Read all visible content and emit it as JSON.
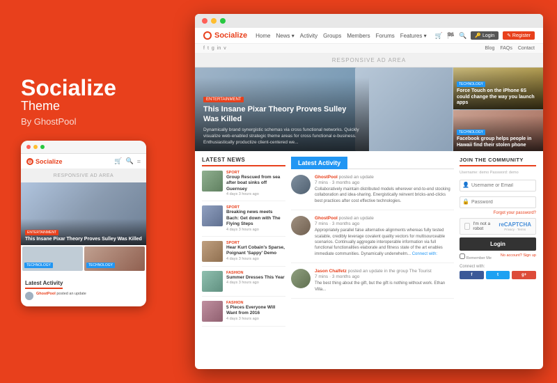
{
  "brand": {
    "title": "Socialize",
    "subtitle": "Theme",
    "by": "By GhostPool"
  },
  "browser_dots": [
    "red",
    "yellow",
    "green"
  ],
  "site": {
    "logo": "Socialize",
    "nav": [
      "Home",
      "News ▾",
      "Activity",
      "Groups",
      "Members",
      "Forums",
      "Features ▾"
    ],
    "nav_icons": [
      "🛒",
      "🔍",
      "Login",
      "Register"
    ],
    "secondary_nav": [
      "Blog",
      "FAQs",
      "Contact"
    ],
    "social_links": [
      "f",
      "t",
      "g+",
      "in",
      "v"
    ]
  },
  "ad_area": "RESPONSIVE AD AREA",
  "hero": {
    "tag": "ENTERTAINMENT",
    "title": "This Insane Pixar Theory Proves Sulley Was Killed",
    "desc": "Dynamically brand synergistic schemas via cross functional networks. Quickly visualize web-enabled strategic theme areas for cross functional e-business. Enthusiastically productize client-centered we...",
    "card1_tag": "TECHNOLOGY",
    "card1_title": "Force Touch on the iPhone 6S could change the way you launch apps",
    "card2_tag": "TECHNOLOGY",
    "card2_title": "Facebook group helps people in Hawaii find their stolen phone"
  },
  "latest_news": {
    "header": "LATEST NEWS",
    "items": [
      {
        "category": "SPORT",
        "title": "Group Rescued from sea after boat sinks off Guernsey",
        "date": "4 days 3 hours ago",
        "thumb": "green"
      },
      {
        "category": "SPORT",
        "title": "Breaking news meets Bach: Get down with The Flying Steps",
        "date": "4 days 3 hours ago",
        "thumb": "blue"
      },
      {
        "category": "SPORT",
        "title": "Hear Kurt Cobain's Sparse, Poignant 'Sappy' Demo",
        "date": "4 days 3 hours ago",
        "thumb": "brown"
      },
      {
        "category": "FASHION",
        "title": "Summer Dresses This Year",
        "date": "4 days 3 hours ago",
        "thumb": "teal"
      },
      {
        "category": "FASHION",
        "title": "5 Pieces Everyone Will Want from 2016",
        "date": "4 days 3 hours ago",
        "thumb": "pink"
      }
    ]
  },
  "activity": {
    "title": "Latest Activity",
    "items": [
      {
        "user": "GhostPool",
        "action": "posted an update",
        "time": "7 mins · 3 months ago",
        "text": "Collaboratively maintain distributed models wherever end-to-end stocking collaboration and idea-sharing. Energistically reinvent bricks-and-clicks best practices after cost effective technologies.",
        "read_more": false
      },
      {
        "user": "GhostPool",
        "action": "posted an update",
        "time": "7 mins · 3 months ago",
        "text": "Appropriately parallel false alternative alignments whereas fully tested scalable, credibly leverage covalent quality vectors for multisourceable scenarios. Continually aggregate interoperable information via full functional functionalities elaborate and fitness state of the art enables immediate communities. Dynamically underwhelm...",
        "read_more": true
      },
      {
        "user": "Jason Chalfetz",
        "action": "posted an update in the group The Tourist",
        "time": "7 mins · 3 months ago",
        "text": "The best thing about the gift, but the gift is nothing without work. Ethan Villa...",
        "read_more": false
      }
    ]
  },
  "community": {
    "header": "JOIN THE COMMUNITY",
    "username_placeholder": "Username or Email",
    "username_demo": "Username: demo  Password: demo",
    "password_placeholder": "Password",
    "forgot": "Forgot your password?",
    "captcha_label": "I'm not a robot",
    "captcha_brand": "reCAPTCHA\nPrivacy - Terms",
    "login_btn": "Login",
    "remember_me": "Remember Me",
    "no_account": "No account? Sign up",
    "connect_with": "Connect with:",
    "social_btns": [
      {
        "label": "Facebook",
        "network": "fb"
      },
      {
        "label": "Twitter",
        "network": "tw"
      },
      {
        "label": "Google+",
        "network": "gp"
      }
    ]
  },
  "mobile": {
    "activity_title": "Latest Activity",
    "hero_tag": "ENTERTAINMENT",
    "hero_title": "This Insane Pixar Theory Proves Sulley Was Killed",
    "tech_tag": "TECHNOLOGY",
    "activity_user": "GhostPool",
    "activity_action": "posted an update"
  }
}
